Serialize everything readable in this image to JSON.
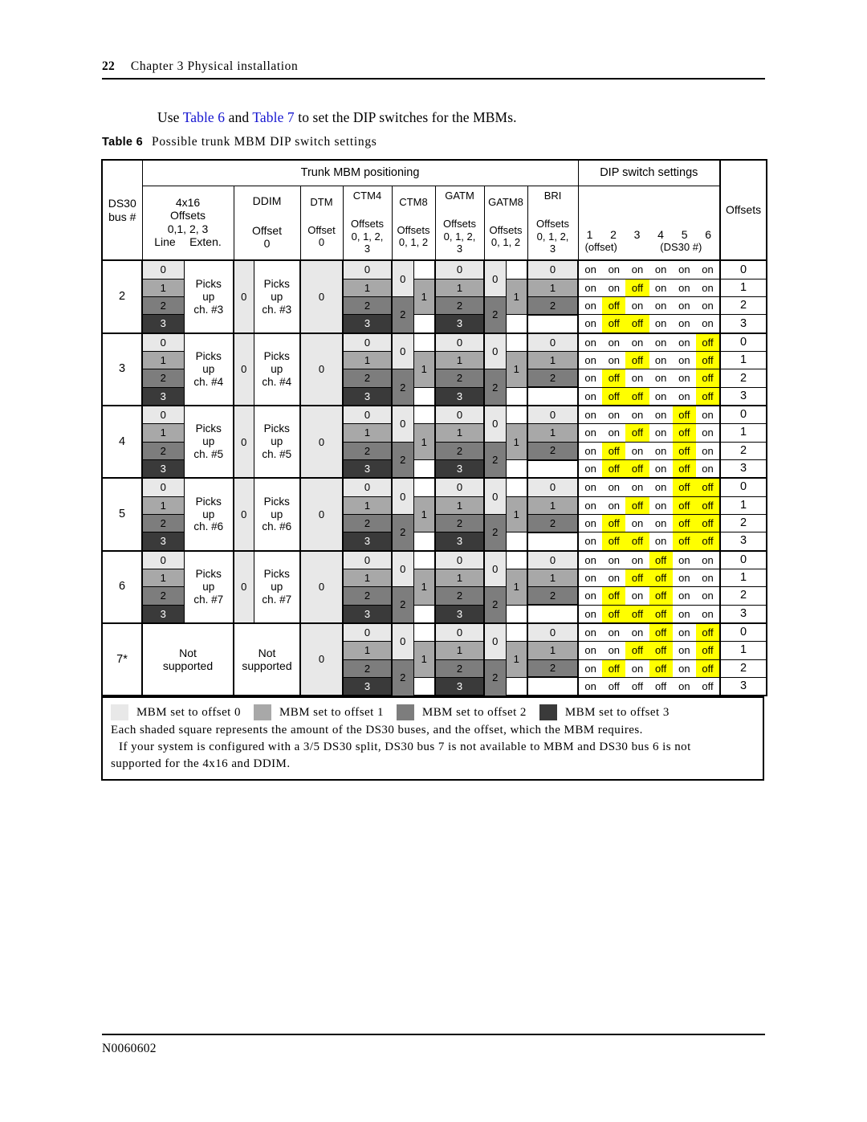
{
  "page": {
    "number": "22",
    "chapter": "Chapter 3  Physical installation",
    "footer_code": "N0060602"
  },
  "intro": {
    "prefix": "Use ",
    "xref1": "Table  6",
    "middle": " and ",
    "xref2": "Table  7",
    "suffix": " to set the DIP switches for the MBMs."
  },
  "caption": {
    "label": "Table 6",
    "text": "Possible trunk MBM DIP switch settings"
  },
  "table": {
    "corner_label_line1": "DS30",
    "corner_label_line2": "bus #",
    "group_positioning": "Trunk MBM positioning",
    "group_dip": "DIP switch settings",
    "offsets_col_header": "Offsets",
    "columns": [
      {
        "name": "4x16",
        "sub1": "Offsets",
        "sub2": "0,1, 2, 3",
        "sub3a": "Line",
        "sub3b": "Exten."
      },
      {
        "name": "DDIM",
        "sub1": "Offset",
        "sub2": "0"
      },
      {
        "name": "DTM",
        "sub1": "Offset",
        "sub2": "0"
      },
      {
        "name": "CTM4",
        "sub1": "Offsets",
        "sub2": "0, 1, 2,",
        "sub3": "3"
      },
      {
        "name": "CTM8",
        "sub1": "Offsets",
        "sub2": "0, 1, 2"
      },
      {
        "name": "GATM",
        "sub1": "Offsets",
        "sub2": "0, 1, 2,",
        "sub3": "3"
      },
      {
        "name": "GATM8",
        "sub1": "Offsets",
        "sub2": "0, 1, 2"
      },
      {
        "name": "BRI",
        "sub1": "Offsets",
        "sub2": "0, 1, 2,",
        "sub3": "3"
      }
    ],
    "dip_header": {
      "numbers": [
        "1",
        "2",
        "3",
        "4",
        "5",
        "6"
      ],
      "note_offset": "(offset)",
      "note_ds30": "(DS30 #)"
    },
    "blocks": [
      {
        "bus": "2",
        "picks": "Picks up ch. #3",
        "picks_l1": "Picks",
        "picks_l2": "up",
        "picks_l3": "ch. #3",
        "offsets": [
          "0",
          "1",
          "2",
          "3"
        ],
        "dip": [
          [
            "on",
            "on",
            "on",
            "on",
            "on",
            "on"
          ],
          [
            "on",
            "on",
            "off",
            "on",
            "on",
            "on"
          ],
          [
            "on",
            "off",
            "on",
            "on",
            "on",
            "on"
          ],
          [
            "on",
            "off",
            "off",
            "on",
            "on",
            "on"
          ]
        ]
      },
      {
        "bus": "3",
        "picks_l1": "Picks",
        "picks_l2": "up",
        "picks_l3": "ch. #4",
        "offsets": [
          "0",
          "1",
          "2",
          "3"
        ],
        "dip": [
          [
            "on",
            "on",
            "on",
            "on",
            "on",
            "off"
          ],
          [
            "on",
            "on",
            "off",
            "on",
            "on",
            "off"
          ],
          [
            "on",
            "off",
            "on",
            "on",
            "on",
            "off"
          ],
          [
            "on",
            "off",
            "off",
            "on",
            "on",
            "off"
          ]
        ]
      },
      {
        "bus": "4",
        "picks_l1": "Picks",
        "picks_l2": "up",
        "picks_l3": "ch. #5",
        "offsets": [
          "0",
          "1",
          "2",
          "3"
        ],
        "dip": [
          [
            "on",
            "on",
            "on",
            "on",
            "off",
            "on"
          ],
          [
            "on",
            "on",
            "off",
            "on",
            "off",
            "on"
          ],
          [
            "on",
            "off",
            "on",
            "on",
            "off",
            "on"
          ],
          [
            "on",
            "off",
            "off",
            "on",
            "off",
            "on"
          ]
        ]
      },
      {
        "bus": "5",
        "picks_l1": "Picks",
        "picks_l2": "up",
        "picks_l3": "ch. #6",
        "offsets": [
          "0",
          "1",
          "2",
          "3"
        ],
        "dip": [
          [
            "on",
            "on",
            "on",
            "on",
            "off",
            "off"
          ],
          [
            "on",
            "on",
            "off",
            "on",
            "off",
            "off"
          ],
          [
            "on",
            "off",
            "on",
            "on",
            "off",
            "off"
          ],
          [
            "on",
            "off",
            "off",
            "on",
            "off",
            "off"
          ]
        ]
      },
      {
        "bus": "6",
        "picks_l1": "Picks",
        "picks_l2": "up",
        "picks_l3": "ch. #7",
        "offsets": [
          "0",
          "1",
          "2",
          "3"
        ],
        "dip": [
          [
            "on",
            "on",
            "on",
            "off",
            "on",
            "on"
          ],
          [
            "on",
            "on",
            "off",
            "off",
            "on",
            "on"
          ],
          [
            "on",
            "off",
            "on",
            "off",
            "on",
            "on"
          ],
          [
            "on",
            "off",
            "off",
            "off",
            "on",
            "on"
          ]
        ]
      },
      {
        "bus": "7*",
        "not_supported_l1": "Not",
        "not_supported_l2": "supported",
        "offsets": [
          "0",
          "1",
          "2",
          "3"
        ],
        "dip": [
          [
            "on",
            "on",
            "on",
            "off",
            "on",
            "off"
          ],
          [
            "on",
            "on",
            "off",
            "off",
            "on",
            "off"
          ],
          [
            "on",
            "off",
            "on",
            "off",
            "on",
            "off"
          ],
          [
            "on",
            "off",
            "off",
            "off",
            "on",
            "off"
          ]
        ],
        "dip_no_highlight_row": 3
      }
    ],
    "cell_values": {
      "zero": "0",
      "one": "1",
      "two": "2",
      "three": "3",
      "blank": ""
    }
  },
  "legend": {
    "items": [
      {
        "color": "#e8e8e8",
        "label": "MBM set to offset 0"
      },
      {
        "color": "#a8a8a8",
        "label": "MBM set to offset 1"
      },
      {
        "color": "#7d7d7d",
        "label": "MBM set to offset 2"
      },
      {
        "color": "#3a3a3a",
        "label": "MBM set to offset 3"
      }
    ],
    "note1": "Each shaded square represents the amount of the DS30 buses, and the offset, which the MBM requires.",
    "note2a": "If your system is configured with a 3/5 DS30 split, DS30 bus 7 is not available to MBM and DS30 bus 6 is not",
    "note2b": "supported for the 4x16 and DDIM."
  },
  "colors": {
    "xref_blue": "#1414cf",
    "switch_off_highlight": "#ffff00",
    "offset0": "#e8e8e8",
    "offset1": "#a8a8a8",
    "offset2": "#7d7d7d",
    "offset3": "#3a3a3a"
  }
}
